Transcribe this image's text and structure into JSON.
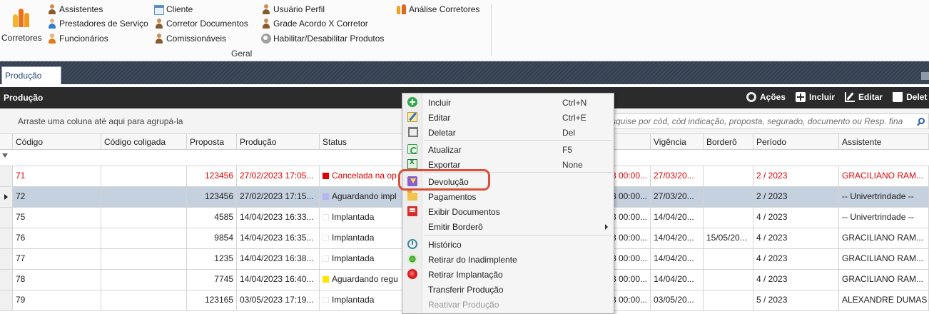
{
  "ribbon": {
    "big_button_label": "Corretores",
    "items_col1": [
      "Assistentes",
      "Prestadores de Serviço",
      "Funcionários"
    ],
    "items_col2": [
      "Cliente",
      "Corretor Documentos",
      "Comissionáveis"
    ],
    "items_col3": [
      "Usuário Perfil",
      "Grade Acordo X Corretor",
      "Habilitar/Desabilitar Produtos"
    ],
    "item_col4": "Análise Corretores",
    "group_label": "Geral"
  },
  "tab": {
    "label": "Produção"
  },
  "panel": {
    "title": "Produção",
    "actions": {
      "acoes": "Ações",
      "incluir": "Incluir",
      "editar": "Editar",
      "deletar": "Delet"
    }
  },
  "groupbar": {
    "hint": "Arraste uma coluna até aqui para agrupá-la",
    "search_placeholder": "squise por cód, cód indicação, proposta, segurado, documento ou Resp. fina"
  },
  "grid": {
    "headers": [
      "Código",
      "Código coligada",
      "Proposta",
      "Produção",
      "Status",
      "",
      "Vigência",
      "Borderô",
      "Período",
      "Assistente"
    ],
    "rows": [
      {
        "codigo": "71",
        "proposta": "123456",
        "producao": "27/02/2023 17:05...",
        "status": "Cancelada na op",
        "status_color": "#e00000",
        "col6": "23 00:00...",
        "vigencia": "27/03/20...",
        "bordero": "",
        "periodo": "2 / 2023",
        "assistente": "GRACILIANO RAM...",
        "red": true,
        "selected": false
      },
      {
        "codigo": "72",
        "proposta": "123456",
        "producao": "27/02/2023 17:15...",
        "status": "Aguardando impl",
        "status_color": "#b4b4f0",
        "col6": "23 00:00...",
        "vigencia": "27/03/20...",
        "bordero": "",
        "periodo": "2 / 2023",
        "assistente": "-- Univertrindade --",
        "red": false,
        "selected": true
      },
      {
        "codigo": "75",
        "proposta": "4585",
        "producao": "14/04/2023 16:33...",
        "status": "Implantada",
        "status_color": "#ffffff",
        "col6": "23 00:00...",
        "vigencia": "14/04/20...",
        "bordero": "",
        "periodo": "4 / 2023",
        "assistente": "-- Univertrindade --",
        "red": false,
        "selected": false
      },
      {
        "codigo": "76",
        "proposta": "9854",
        "producao": "14/04/2023 16:35...",
        "status": "Implantada",
        "status_color": "#ffffff",
        "col6": "23 00:00...",
        "vigencia": "14/04/20...",
        "bordero": "15/05/20...",
        "periodo": "4 / 2023",
        "assistente": "GRACILIANO RAM...",
        "red": false,
        "selected": false
      },
      {
        "codigo": "77",
        "proposta": "1235",
        "producao": "14/04/2023 16:38...",
        "status": "Implantada",
        "status_color": "#ffffff",
        "col6": "23 00:00...",
        "vigencia": "14/04/20...",
        "bordero": "",
        "periodo": "4 / 2023",
        "assistente": "GRACILIANO RAM...",
        "red": false,
        "selected": false
      },
      {
        "codigo": "78",
        "proposta": "7745",
        "producao": "14/04/2023 16:40...",
        "status": "Aguardando regu",
        "status_color": "#ffe600",
        "col6": "23 00:00...",
        "vigencia": "14/04/20...",
        "bordero": "",
        "periodo": "4 / 2023",
        "assistente": "GRACILIANO RAM...",
        "red": false,
        "selected": false
      },
      {
        "codigo": "79",
        "proposta": "123165",
        "producao": "03/05/2023 17:19...",
        "status": "Implantada",
        "status_color": "#ffffff",
        "col6": "23 00:00...",
        "vigencia": "03/05/20...",
        "bordero": "",
        "periodo": "5 / 2023",
        "assistente": "ALEXANDRE DUMAS",
        "red": false,
        "selected": false
      }
    ]
  },
  "context_menu": {
    "items": [
      {
        "label": "Incluir",
        "shortcut": "Ctrl+N",
        "icon": "add-icon"
      },
      {
        "label": "Editar",
        "shortcut": "Ctrl+E",
        "icon": "edit-icon"
      },
      {
        "label": "Deletar",
        "shortcut": "Del",
        "icon": "trash-icon"
      },
      {
        "label": "Atualizar",
        "shortcut": "F5",
        "icon": "refresh-icon"
      },
      {
        "label": "Exportar",
        "shortcut": "None",
        "icon": "excel-icon"
      },
      {
        "label": "Devolução",
        "shortcut": "",
        "icon": "return-icon"
      },
      {
        "label": "Pagamentos",
        "shortcut": "",
        "icon": "folder-icon"
      },
      {
        "label": "Exibir Documentos",
        "shortcut": "",
        "icon": "pdf-icon"
      },
      {
        "label": "Emitir Borderô",
        "shortcut": "",
        "icon": ""
      },
      {
        "label": "Histórico",
        "shortcut": "",
        "icon": "history-icon"
      },
      {
        "label": "Retirar do Inadimplente",
        "shortcut": "",
        "icon": "green-dot-icon"
      },
      {
        "label": "Retirar Implantação",
        "shortcut": "",
        "icon": "red-dot-icon"
      },
      {
        "label": "Transferir Produção",
        "shortcut": "",
        "icon": ""
      },
      {
        "label": "Reativar Produção",
        "shortcut": "",
        "icon": ""
      }
    ]
  },
  "colors": {
    "accent_red": "#e00000",
    "highlight_ring": "#d9503a",
    "selected_row": "#c5d1de",
    "panel_header": "#2b2b2b"
  }
}
